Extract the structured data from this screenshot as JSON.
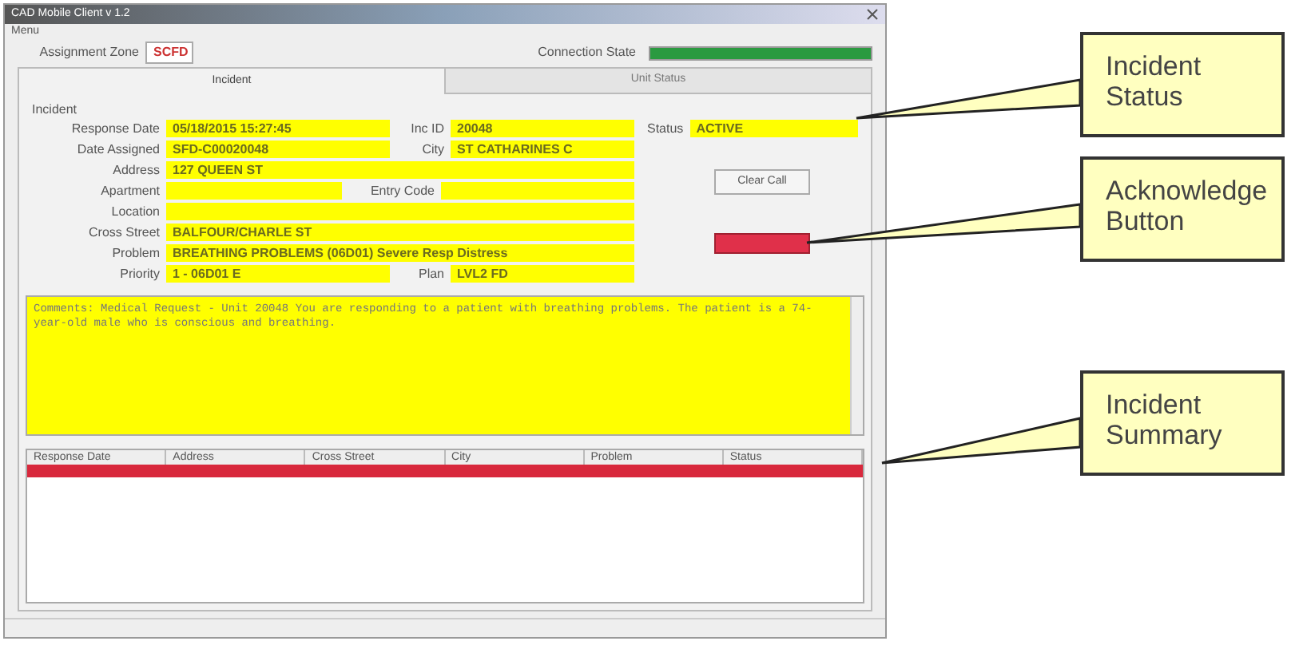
{
  "window": {
    "title": "CAD Mobile Client v 1.2"
  },
  "menu": [
    "Menu"
  ],
  "assignment_zone": {
    "label": "Assignment Zone",
    "value": "SCFD"
  },
  "connection_state": {
    "label": "Connection State",
    "level": 1
  },
  "tabs": [
    {
      "label": "Incident",
      "selected": true
    },
    {
      "label": "Unit Status",
      "selected": false
    }
  ],
  "group": "Incident",
  "fields": [
    {
      "kind": "pair",
      "label": "Response Date",
      "value": "05/18/2015 15:27:45",
      "label2": "Inc ID",
      "value2": "20048"
    },
    {
      "kind": "pair",
      "label": "Date Assigned",
      "value": "SFD-C00020048",
      "label2": "City",
      "value2": "ST CATHARINES C"
    },
    {
      "kind": "single",
      "label": "Address",
      "value": "127 QUEEN ST"
    },
    {
      "kind": "half",
      "label": "Apartment",
      "label2": "Entry Code"
    },
    {
      "kind": "single",
      "label": "Location"
    },
    {
      "kind": "single",
      "label": "Cross Street",
      "value": "BALFOUR/CHARLE ST"
    },
    {
      "kind": "single",
      "label": "Problem",
      "value": "BREATHING PROBLEMS (06D01) Severe Resp Distress"
    },
    {
      "kind": "pair",
      "label": "Priority",
      "value": "1 - 06D01 E",
      "label2": "Plan",
      "value2": "LVL2 FD"
    }
  ],
  "status": {
    "label": "Status",
    "value": "ACTIVE"
  },
  "clear_button": "Clear Call",
  "acknowledge_button": {
    "highlighted": true
  },
  "notes": "Comments: Medical Request - Unit 20048 You are responding to a patient with breathing problems. The patient is a 74-year-old male who is conscious and breathing.",
  "table": {
    "columns": [
      "Response Date",
      "Address",
      "Cross Street",
      "City",
      "Problem",
      "Status"
    ],
    "rows": [
      {
        "selected": true
      }
    ]
  },
  "callouts": [
    {
      "text": "Incident Status"
    },
    {
      "text": "Acknowledge Button"
    },
    {
      "text": "Incident Summary"
    }
  ]
}
